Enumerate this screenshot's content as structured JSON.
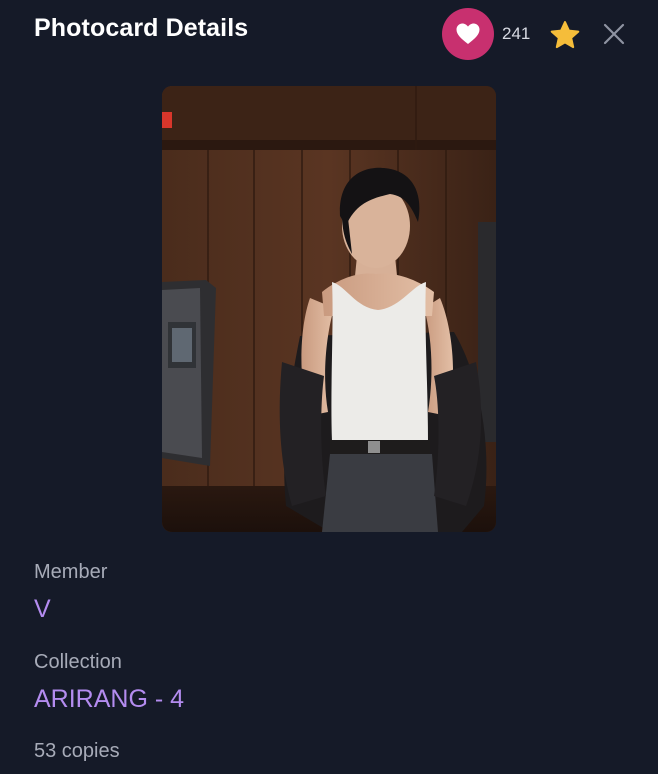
{
  "header": {
    "title": "Photocard Details",
    "like_count": "241",
    "like_icon": "heart-icon",
    "favorite_icon": "star-icon",
    "close_icon": "close-icon"
  },
  "photocard": {
    "image": "photocard-image"
  },
  "details": {
    "member_label": "Member",
    "member_value": "V",
    "collection_label": "Collection",
    "collection_value": "ARIRANG - 4",
    "copies": "53 copies"
  },
  "colors": {
    "background": "#151a28",
    "like_accent": "#c8306f",
    "star": "#f5bd3a",
    "value_text": "#b48cf0",
    "label_text": "#a7abb8"
  }
}
